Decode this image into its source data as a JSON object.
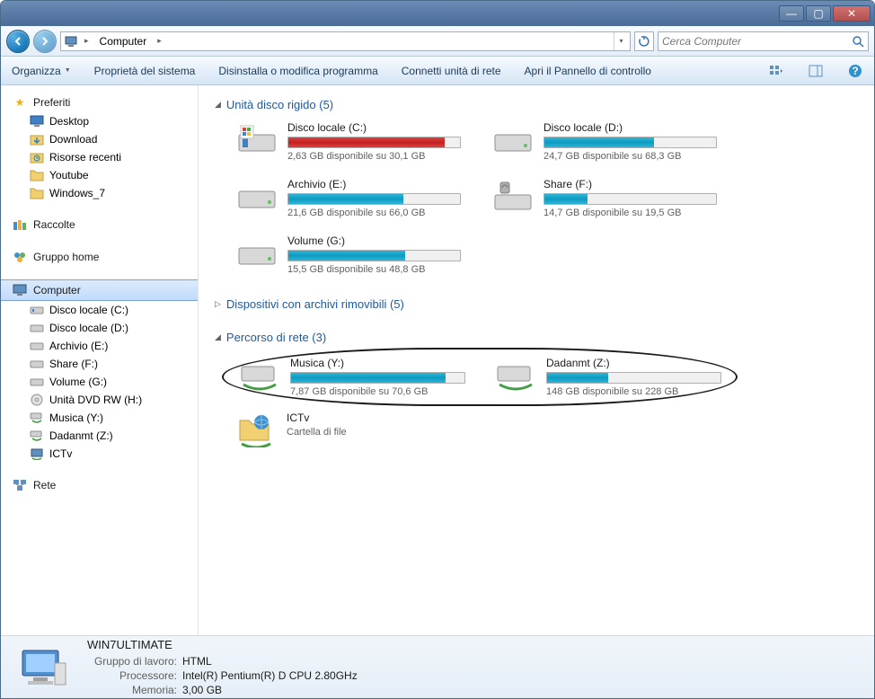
{
  "titlebar": {
    "min": "—",
    "max": "▢",
    "close": "✕"
  },
  "nav": {
    "breadcrumb": "Computer",
    "search_placeholder": "Cerca Computer"
  },
  "toolbar": {
    "organize": "Organizza",
    "properties": "Proprietà del sistema",
    "uninstall": "Disinstalla o modifica programma",
    "map_drive": "Connetti unità di rete",
    "control_panel": "Apri il Pannello di controllo"
  },
  "sidebar": {
    "favorites": {
      "label": "Preferiti",
      "items": [
        "Desktop",
        "Download",
        "Risorse recenti",
        "Youtube",
        "Windows_7"
      ]
    },
    "libraries": {
      "label": "Raccolte"
    },
    "homegroup": {
      "label": "Gruppo home"
    },
    "computer": {
      "label": "Computer",
      "items": [
        "Disco locale (C:)",
        "Disco locale (D:)",
        "Archivio (E:)",
        "Share (F:)",
        "Volume (G:)",
        "Unità DVD RW (H:)",
        "Musica (Y:)",
        "Dadanmt (Z:)",
        "ICTv"
      ]
    },
    "network": {
      "label": "Rete"
    }
  },
  "sections": {
    "hdd": {
      "title": "Unità disco rigido (5)",
      "expanded": true
    },
    "removable": {
      "title": "Dispositivi con archivi rimovibili (5)",
      "expanded": false
    },
    "network": {
      "title": "Percorso di rete (3)",
      "expanded": true
    }
  },
  "drives": {
    "c": {
      "name": "Disco locale (C:)",
      "text": "2,63 GB disponibile su 30,1 GB",
      "fill": 91,
      "red": true
    },
    "d": {
      "name": "Disco locale (D:)",
      "text": "24,7 GB disponibile su 68,3 GB",
      "fill": 64,
      "red": false
    },
    "e": {
      "name": "Archivio (E:)",
      "text": "21,6 GB disponibile su 66,0 GB",
      "fill": 67,
      "red": false
    },
    "f": {
      "name": "Share (F:)",
      "text": "14,7 GB disponibile su 19,5 GB",
      "fill": 25,
      "red": false
    },
    "g": {
      "name": "Volume (G:)",
      "text": "15,5 GB disponibile su 48,8 GB",
      "fill": 68,
      "red": false
    },
    "y": {
      "name": "Musica (Y:)",
      "text": "7,87 GB disponibile su 70,6 GB",
      "fill": 89,
      "red": false
    },
    "z": {
      "name": "Dadanmt (Z:)",
      "text": "148 GB disponibile su 228 GB",
      "fill": 35,
      "red": false
    }
  },
  "netfolder": {
    "name": "ICTv",
    "sub": "Cartella di file"
  },
  "status": {
    "name": "WIN7ULTIMATE",
    "workgroup_label": "Gruppo di lavoro:",
    "workgroup": "HTML",
    "cpu_label": "Processore:",
    "cpu": "Intel(R) Pentium(R) D CPU 2.80GHz",
    "mem_label": "Memoria:",
    "mem": "3,00 GB"
  }
}
